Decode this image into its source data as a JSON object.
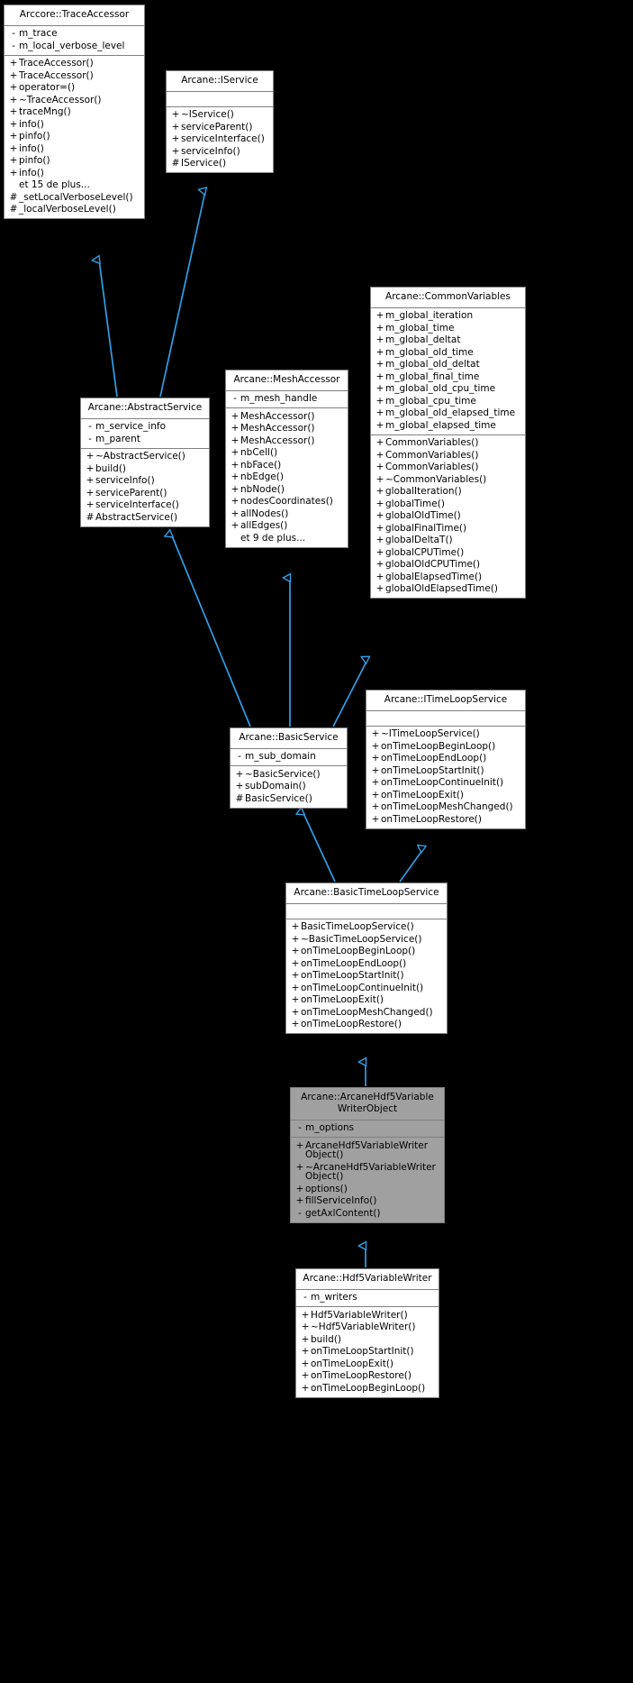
{
  "diagram": {
    "type": "uml-class-inheritance-diagram",
    "background_color": "#000000",
    "edge_color": "#2f9fe8",
    "box_fill": "#ffffff",
    "box_highlight_fill": "#a0a0a0",
    "box_border": "#808080",
    "more_label_fr": "et 15 de plus..."
  },
  "classes": {
    "trace_accessor": {
      "title": "Arccore::TraceAccessor",
      "attributes": [
        {
          "vis": "-",
          "name": "m_trace"
        },
        {
          "vis": "-",
          "name": "m_local_verbose_level"
        }
      ],
      "operations": [
        {
          "vis": "+",
          "name": "TraceAccessor()"
        },
        {
          "vis": "+",
          "name": "TraceAccessor()"
        },
        {
          "vis": "+",
          "name": "operator=()"
        },
        {
          "vis": "+",
          "name": "~TraceAccessor()"
        },
        {
          "vis": "+",
          "name": "traceMng()"
        },
        {
          "vis": "+",
          "name": "info()"
        },
        {
          "vis": "+",
          "name": "pinfo()"
        },
        {
          "vis": "+",
          "name": "info()"
        },
        {
          "vis": "+",
          "name": "pinfo()"
        },
        {
          "vis": "+",
          "name": "info()"
        },
        {
          "vis": "",
          "name": "et 15 de plus..."
        },
        {
          "vis": "#",
          "name": "_setLocalVerboseLevel()"
        },
        {
          "vis": "#",
          "name": "_localVerboseLevel()"
        }
      ]
    },
    "iservice": {
      "title": "Arcane::IService",
      "attributes": [],
      "operations": [
        {
          "vis": "+",
          "name": "~IService()"
        },
        {
          "vis": "+",
          "name": "serviceParent()"
        },
        {
          "vis": "+",
          "name": "serviceInterface()"
        },
        {
          "vis": "+",
          "name": "serviceInfo()"
        },
        {
          "vis": "#",
          "name": "IService()"
        }
      ]
    },
    "abstract_service": {
      "title": "Arcane::AbstractService",
      "attributes": [
        {
          "vis": "-",
          "name": "m_service_info"
        },
        {
          "vis": "-",
          "name": "m_parent"
        }
      ],
      "operations": [
        {
          "vis": "+",
          "name": "~AbstractService()"
        },
        {
          "vis": "+",
          "name": "build()"
        },
        {
          "vis": "+",
          "name": "serviceInfo()"
        },
        {
          "vis": "+",
          "name": "serviceParent()"
        },
        {
          "vis": "+",
          "name": "serviceInterface()"
        },
        {
          "vis": "#",
          "name": "AbstractService()"
        }
      ]
    },
    "mesh_accessor": {
      "title": "Arcane::MeshAccessor",
      "attributes": [
        {
          "vis": "-",
          "name": "m_mesh_handle"
        }
      ],
      "operations": [
        {
          "vis": "+",
          "name": "MeshAccessor()"
        },
        {
          "vis": "+",
          "name": "MeshAccessor()"
        },
        {
          "vis": "+",
          "name": "MeshAccessor()"
        },
        {
          "vis": "+",
          "name": "nbCell()"
        },
        {
          "vis": "+",
          "name": "nbFace()"
        },
        {
          "vis": "+",
          "name": "nbEdge()"
        },
        {
          "vis": "+",
          "name": "nbNode()"
        },
        {
          "vis": "+",
          "name": "nodesCoordinates()"
        },
        {
          "vis": "+",
          "name": "allNodes()"
        },
        {
          "vis": "+",
          "name": "allEdges()"
        },
        {
          "vis": "",
          "name": "et 9 de plus..."
        }
      ]
    },
    "common_variables": {
      "title": "Arcane::CommonVariables",
      "attributes": [
        {
          "vis": "+",
          "name": "m_global_iteration"
        },
        {
          "vis": "+",
          "name": "m_global_time"
        },
        {
          "vis": "+",
          "name": "m_global_deltat"
        },
        {
          "vis": "+",
          "name": "m_global_old_time"
        },
        {
          "vis": "+",
          "name": "m_global_old_deltat"
        },
        {
          "vis": "+",
          "name": "m_global_final_time"
        },
        {
          "vis": "+",
          "name": "m_global_old_cpu_time"
        },
        {
          "vis": "+",
          "name": "m_global_cpu_time"
        },
        {
          "vis": "+",
          "name": "m_global_old_elapsed_time"
        },
        {
          "vis": "+",
          "name": "m_global_elapsed_time"
        }
      ],
      "operations": [
        {
          "vis": "+",
          "name": "CommonVariables()"
        },
        {
          "vis": "+",
          "name": "CommonVariables()"
        },
        {
          "vis": "+",
          "name": "CommonVariables()"
        },
        {
          "vis": "+",
          "name": "~CommonVariables()"
        },
        {
          "vis": "+",
          "name": "globalIteration()"
        },
        {
          "vis": "+",
          "name": "globalTime()"
        },
        {
          "vis": "+",
          "name": "globalOldTime()"
        },
        {
          "vis": "+",
          "name": "globalFinalTime()"
        },
        {
          "vis": "+",
          "name": "globalDeltaT()"
        },
        {
          "vis": "+",
          "name": "globalCPUTime()"
        },
        {
          "vis": "+",
          "name": "globalOldCPUTime()"
        },
        {
          "vis": "+",
          "name": "globalElapsedTime()"
        },
        {
          "vis": "+",
          "name": "globalOldElapsedTime()"
        }
      ]
    },
    "basic_service": {
      "title": "Arcane::BasicService",
      "attributes": [
        {
          "vis": "-",
          "name": "m_sub_domain"
        }
      ],
      "operations": [
        {
          "vis": "+",
          "name": "~BasicService()"
        },
        {
          "vis": "+",
          "name": "subDomain()"
        },
        {
          "vis": "#",
          "name": "BasicService()"
        }
      ]
    },
    "itimeloop_service": {
      "title": "Arcane::ITimeLoopService",
      "attributes": [],
      "operations": [
        {
          "vis": "+",
          "name": "~ITimeLoopService()"
        },
        {
          "vis": "+",
          "name": "onTimeLoopBeginLoop()"
        },
        {
          "vis": "+",
          "name": "onTimeLoopEndLoop()"
        },
        {
          "vis": "+",
          "name": "onTimeLoopStartInit()"
        },
        {
          "vis": "+",
          "name": "onTimeLoopContinueInit()"
        },
        {
          "vis": "+",
          "name": "onTimeLoopExit()"
        },
        {
          "vis": "+",
          "name": "onTimeLoopMeshChanged()"
        },
        {
          "vis": "+",
          "name": "onTimeLoopRestore()"
        }
      ]
    },
    "basic_timeloop_service": {
      "title": "Arcane::BasicTimeLoopService",
      "attributes": [],
      "operations": [
        {
          "vis": "+",
          "name": "BasicTimeLoopService()"
        },
        {
          "vis": "+",
          "name": "~BasicTimeLoopService()"
        },
        {
          "vis": "+",
          "name": "onTimeLoopBeginLoop()"
        },
        {
          "vis": "+",
          "name": "onTimeLoopEndLoop()"
        },
        {
          "vis": "+",
          "name": "onTimeLoopStartInit()"
        },
        {
          "vis": "+",
          "name": "onTimeLoopContinueInit()"
        },
        {
          "vis": "+",
          "name": "onTimeLoopExit()"
        },
        {
          "vis": "+",
          "name": "onTimeLoopMeshChanged()"
        },
        {
          "vis": "+",
          "name": "onTimeLoopRestore()"
        }
      ]
    },
    "arcane_hdf5_writer_object": {
      "title": "Arcane::ArcaneHdf5Variable\nWriterObject",
      "highlight": true,
      "attributes": [
        {
          "vis": "-",
          "name": "m_options"
        }
      ],
      "operations": [
        {
          "vis": "+",
          "name": "ArcaneHdf5VariableWriter\nObject()"
        },
        {
          "vis": "+",
          "name": "~ArcaneHdf5VariableWriter\nObject()"
        },
        {
          "vis": "+",
          "name": "options()"
        },
        {
          "vis": "+",
          "name": "fillServiceInfo()"
        },
        {
          "vis": "-",
          "name": "getAxlContent()"
        }
      ]
    },
    "hdf5_variable_writer": {
      "title": "Arcane::Hdf5VariableWriter",
      "attributes": [
        {
          "vis": "-",
          "name": "m_writers"
        }
      ],
      "operations": [
        {
          "vis": "+",
          "name": "Hdf5VariableWriter()"
        },
        {
          "vis": "+",
          "name": "~Hdf5VariableWriter()"
        },
        {
          "vis": "+",
          "name": "build()"
        },
        {
          "vis": "+",
          "name": "onTimeLoopStartInit()"
        },
        {
          "vis": "+",
          "name": "onTimeLoopExit()"
        },
        {
          "vis": "+",
          "name": "onTimeLoopRestore()"
        },
        {
          "vis": "+",
          "name": "onTimeLoopBeginLoop()"
        }
      ]
    }
  },
  "inheritance_edges": [
    {
      "from": "abstract_service",
      "to": "trace_accessor"
    },
    {
      "from": "abstract_service",
      "to": "iservice"
    },
    {
      "from": "basic_service",
      "to": "abstract_service"
    },
    {
      "from": "basic_service",
      "to": "mesh_accessor"
    },
    {
      "from": "basic_service",
      "to": "common_variables"
    },
    {
      "from": "basic_timeloop_service",
      "to": "basic_service"
    },
    {
      "from": "basic_timeloop_service",
      "to": "itimeloop_service"
    },
    {
      "from": "arcane_hdf5_writer_object",
      "to": "basic_timeloop_service"
    },
    {
      "from": "hdf5_variable_writer",
      "to": "arcane_hdf5_writer_object"
    }
  ]
}
